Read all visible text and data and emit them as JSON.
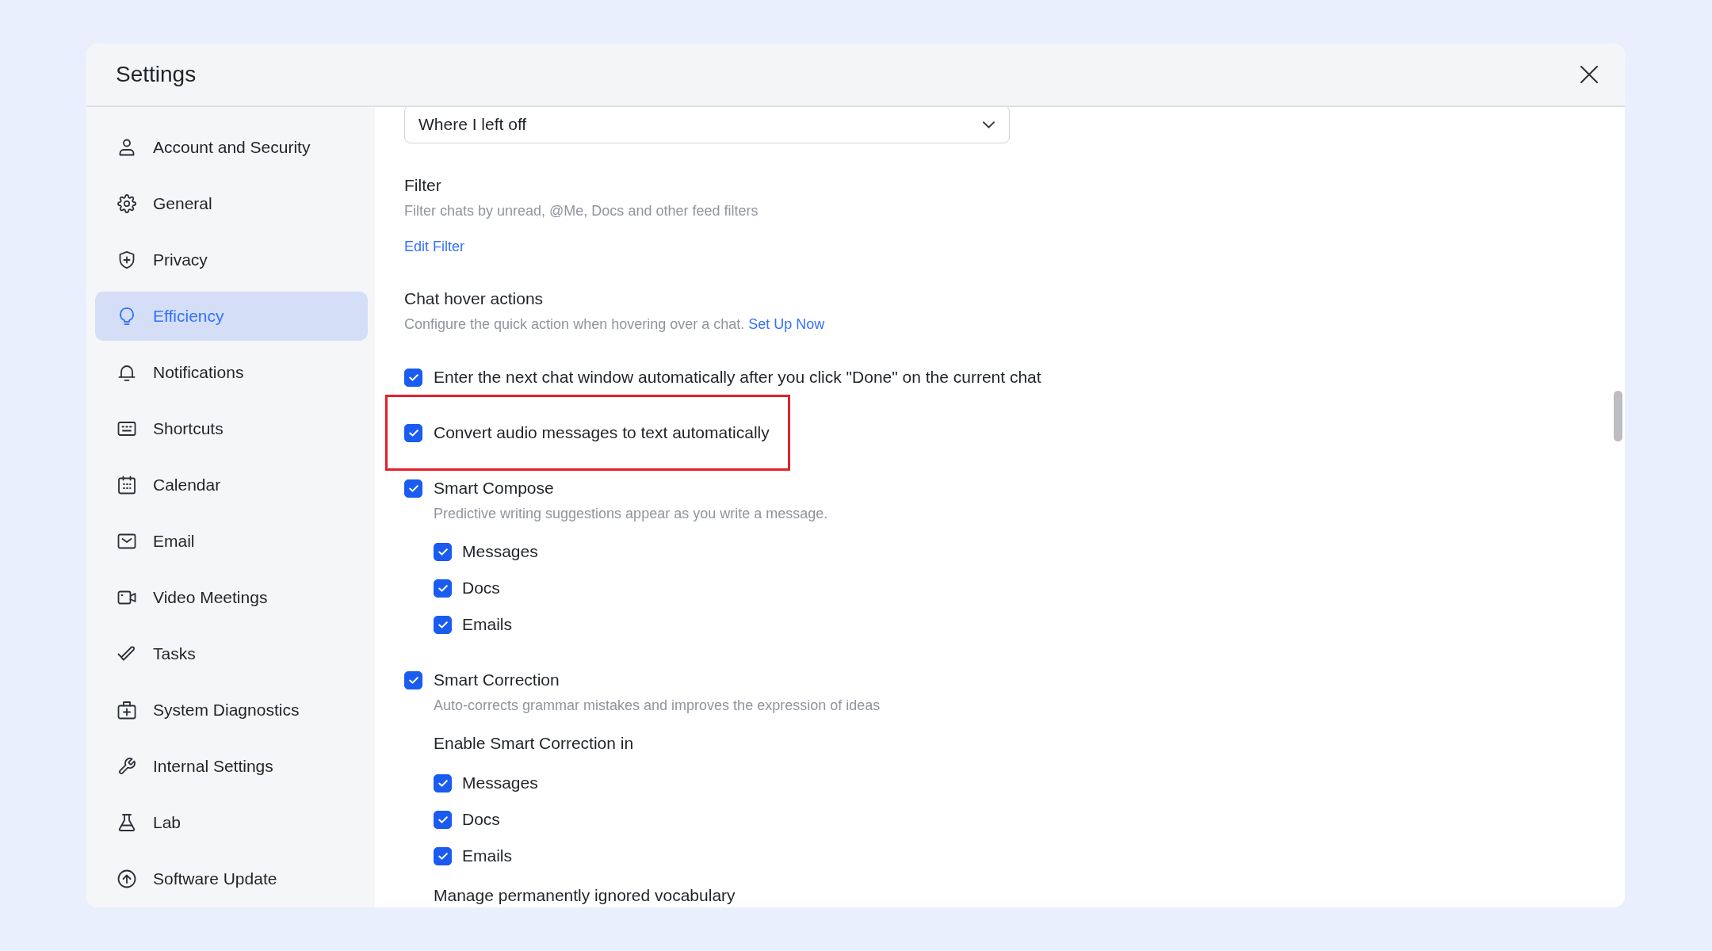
{
  "window": {
    "title": "Settings"
  },
  "sidebar": {
    "items": [
      {
        "label": "Account and Security",
        "selected": false
      },
      {
        "label": "General",
        "selected": false
      },
      {
        "label": "Privacy",
        "selected": false
      },
      {
        "label": "Efficiency",
        "selected": true
      },
      {
        "label": "Notifications",
        "selected": false
      },
      {
        "label": "Shortcuts",
        "selected": false
      },
      {
        "label": "Calendar",
        "selected": false
      },
      {
        "label": "Email",
        "selected": false
      },
      {
        "label": "Video Meetings",
        "selected": false
      },
      {
        "label": "Tasks",
        "selected": false
      },
      {
        "label": "System Diagnostics",
        "selected": false
      },
      {
        "label": "Internal Settings",
        "selected": false
      },
      {
        "label": "Lab",
        "selected": false
      },
      {
        "label": "Software Update",
        "selected": false
      }
    ]
  },
  "content": {
    "dropdown": {
      "value": "Where I left off"
    },
    "settings": [
      {
        "kind": "info",
        "title": "Filter",
        "description": "Filter chats by unread, @Me, Docs and other feed filters",
        "link": "Edit Filter"
      },
      {
        "kind": "info",
        "title": "Chat hover actions",
        "description": "Configure the quick action when hovering over a chat.",
        "inline_link": "Set Up Now"
      },
      {
        "kind": "checkbox",
        "label": "Enter the next chat window automatically after you click \"Done\" on the current chat",
        "checked": true,
        "highlighted": false
      },
      {
        "kind": "checkbox",
        "label": "Convert audio messages to text automatically",
        "checked": true,
        "highlighted": true
      },
      {
        "kind": "checkbox",
        "label": "Smart Compose",
        "description": "Predictive writing suggestions appear as you write a message.",
        "checked": true,
        "highlighted": false,
        "children": [
          {
            "label": "Messages",
            "checked": true
          },
          {
            "label": "Docs",
            "checked": true
          },
          {
            "label": "Emails",
            "checked": true
          }
        ]
      },
      {
        "kind": "checkbox",
        "label": "Smart Correction",
        "description": "Auto-corrects grammar mistakes and improves the expression of ideas",
        "checked": true,
        "highlighted": false,
        "subheading": "Enable Smart Correction in",
        "children": [
          {
            "label": "Messages",
            "checked": true
          },
          {
            "label": "Docs",
            "checked": true
          },
          {
            "label": "Emails",
            "checked": true
          }
        ],
        "footer": "Manage permanently ignored vocabulary"
      }
    ]
  }
}
